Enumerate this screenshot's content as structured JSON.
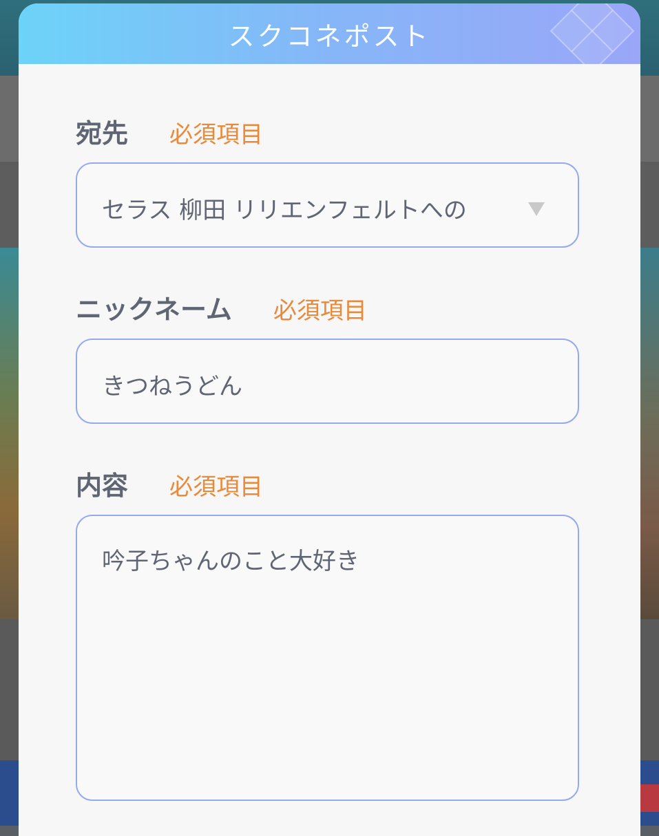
{
  "dialog": {
    "title": "スクコネポスト"
  },
  "fields": {
    "recipient": {
      "label": "宛先",
      "required": "必須項目",
      "value": "セラス 柳田 リリエンフェルトへの"
    },
    "nickname": {
      "label": "ニックネーム",
      "required": "必須項目",
      "value": "きつねうどん"
    },
    "content": {
      "label": "内容",
      "required": "必須項目",
      "value": "吟子ちゃんのこと大好き"
    }
  },
  "colors": {
    "accent_label": "#e98a3a",
    "field_border": "#95a9ee",
    "header_gradient_start": "#6dd3f8",
    "header_gradient_end": "#9aa6f8"
  },
  "icons": {
    "dropdown": "chevron-down-icon"
  }
}
